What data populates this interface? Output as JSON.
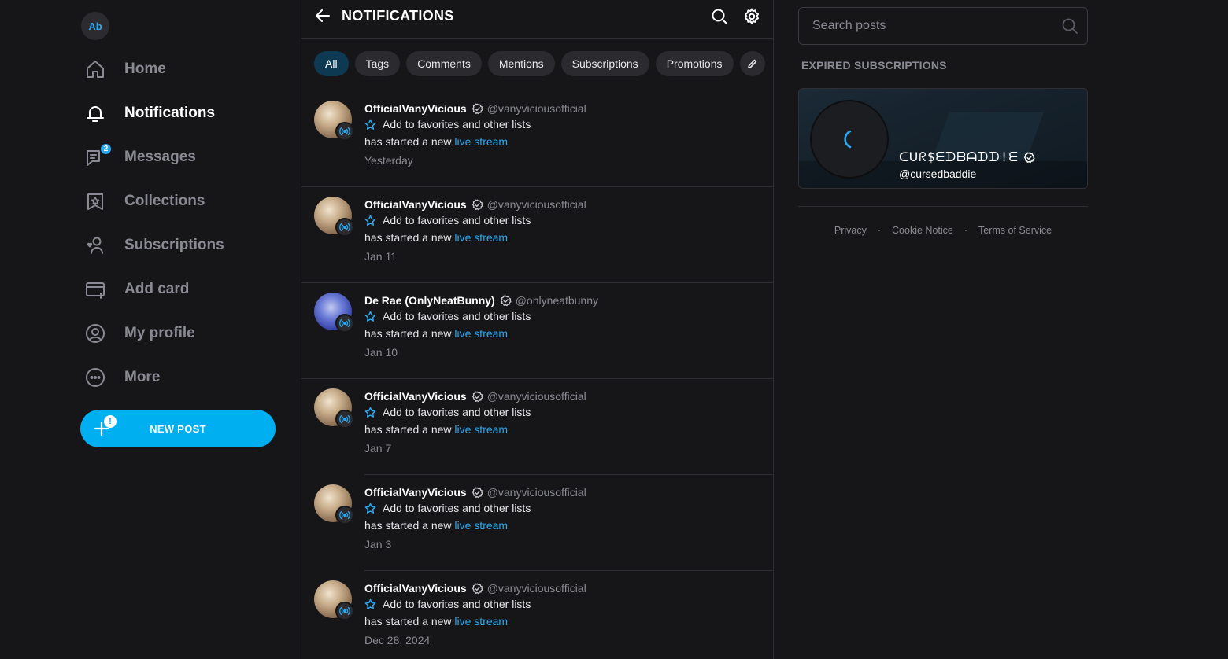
{
  "user": {
    "initials": "Ab"
  },
  "nav": {
    "items": [
      {
        "label": "Home",
        "icon": "home-icon"
      },
      {
        "label": "Notifications",
        "icon": "bell-icon",
        "active": true
      },
      {
        "label": "Messages",
        "icon": "messages-icon",
        "badge": "2"
      },
      {
        "label": "Collections",
        "icon": "collections-icon"
      },
      {
        "label": "Subscriptions",
        "icon": "subscriptions-icon"
      },
      {
        "label": "Add card",
        "icon": "add-card-icon"
      },
      {
        "label": "My profile",
        "icon": "profile-icon"
      },
      {
        "label": "More",
        "icon": "more-icon"
      }
    ],
    "new_post_label": "NEW POST",
    "new_post_alert": "!"
  },
  "main": {
    "title": "NOTIFICATIONS",
    "tabs": [
      "All",
      "Tags",
      "Comments",
      "Mentions",
      "Subscriptions",
      "Promotions"
    ],
    "active_tab": "All",
    "notifications": [
      {
        "name": "OfficialVanyVicious",
        "handle": "@vanyviciousofficial",
        "fav": "Add to favorites and other lists",
        "text": "has started a new ",
        "link": "live stream",
        "date": "Yesterday"
      },
      {
        "name": "OfficialVanyVicious",
        "handle": "@vanyviciousofficial",
        "fav": "Add to favorites and other lists",
        "text": "has started a new ",
        "link": "live stream",
        "date": "Jan 11"
      },
      {
        "name": "De Rae (OnlyNeatBunny)",
        "handle": "@onlyneatbunny",
        "fav": "Add to favorites and other lists",
        "text": "has started a new ",
        "link": "live stream",
        "date": "Jan 10"
      },
      {
        "name": "OfficialVanyVicious",
        "handle": "@vanyviciousofficial",
        "fav": "Add to favorites and other lists",
        "text": "has started a new ",
        "link": "live stream",
        "date": "Jan 7"
      },
      {
        "name": "OfficialVanyVicious",
        "handle": "@vanyviciousofficial",
        "fav": "Add to favorites and other lists",
        "text": "has started a new ",
        "link": "live stream",
        "date": "Jan 3"
      },
      {
        "name": "OfficialVanyVicious",
        "handle": "@vanyviciousofficial",
        "fav": "Add to favorites and other lists",
        "text": "has started a new ",
        "link": "live stream",
        "date": "Dec 28, 2024"
      }
    ]
  },
  "right": {
    "search_placeholder": "Search posts",
    "expired_title": "EXPIRED SUBSCRIPTIONS",
    "expired_card": {
      "name": "ᑕᑌᖇ$ᗴᗪᗷᗩᗪᗪ!ᗴ",
      "handle": "@cursedbaddie"
    },
    "footer": {
      "privacy": "Privacy",
      "cookie": "Cookie Notice",
      "terms": "Terms of Service",
      "separator": "·"
    }
  },
  "colors": {
    "accent": "#00aff0",
    "background": "#161618",
    "muted": "#8a8a94"
  }
}
